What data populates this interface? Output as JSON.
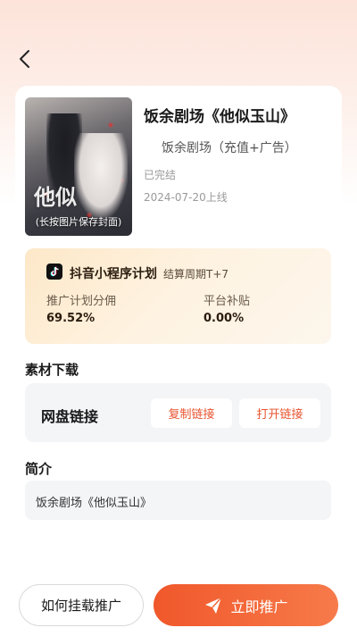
{
  "drama": {
    "title": "饭余剧场《他似玉山》",
    "tag": "饭余剧场（充值+广告）",
    "status": "已完结",
    "date": "2024-07-20上线",
    "poster_title_art": "他似",
    "poster_caption": "(长按图片保存封面)"
  },
  "plan": {
    "icon": "tiktok-icon",
    "title": "抖音小程序计划",
    "cycle": "结算周期T+7",
    "commission_label": "推广计划分佣",
    "commission_value": "69.52%",
    "subsidy_label": "平台补贴",
    "subsidy_value": "0.00%"
  },
  "materials": {
    "section_title": "素材下载",
    "link_label": "网盘链接",
    "copy_button": "复制链接",
    "open_button": "打开链接"
  },
  "intro": {
    "section_title": "简介",
    "text": "饭余剧场《他似玉山》"
  },
  "footer": {
    "how_button": "如何挂载推广",
    "promote_button": "立即推广",
    "promote_icon": "paper-plane-icon"
  },
  "colors": {
    "accent": "#f0582b",
    "accent_light": "#f77a4a",
    "plan_bg": "#fde8c8"
  }
}
